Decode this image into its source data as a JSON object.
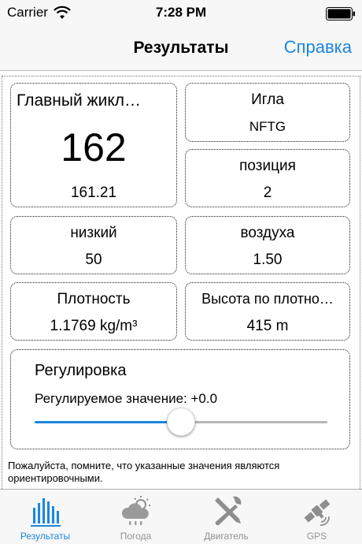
{
  "status_bar": {
    "carrier": "Carrier",
    "time": "7:28 PM"
  },
  "nav": {
    "title": "Результаты",
    "help_label": "Справка"
  },
  "cards": {
    "main_jet": {
      "label": "Главный жикл…",
      "big_value": "162",
      "value": "161.21"
    },
    "needle": {
      "label": "Игла",
      "value": "NFTG"
    },
    "position": {
      "label": "позиция",
      "value": "2"
    },
    "low": {
      "label": "низкий",
      "value": "50"
    },
    "air": {
      "label": "воздуха",
      "value": "1.50"
    },
    "density": {
      "label": "Плотность",
      "value": "1.1769 kg/m³"
    },
    "density_altitude": {
      "label": "Высота по плотно…",
      "value": "415 m"
    }
  },
  "adjustment": {
    "title": "Регулировка",
    "value_text": "Регулируемое значение: +0.0",
    "slider_fraction": 0.5
  },
  "disclaimer": "Пожалуйста, помните, что указанные значения являются ориентировочными.",
  "tabs": [
    {
      "label": "Результаты",
      "icon": "bar-chart-icon",
      "active": true
    },
    {
      "label": "Погода",
      "icon": "weather-cloud-icon",
      "active": false
    },
    {
      "label": "Двигатель",
      "icon": "tools-icon",
      "active": false
    },
    {
      "label": "GPS",
      "icon": "satellite-icon",
      "active": false
    }
  ],
  "colors": {
    "accent": "#1a86de",
    "inactive_tab": "#929292",
    "bar_background": "#f7f7f7"
  }
}
